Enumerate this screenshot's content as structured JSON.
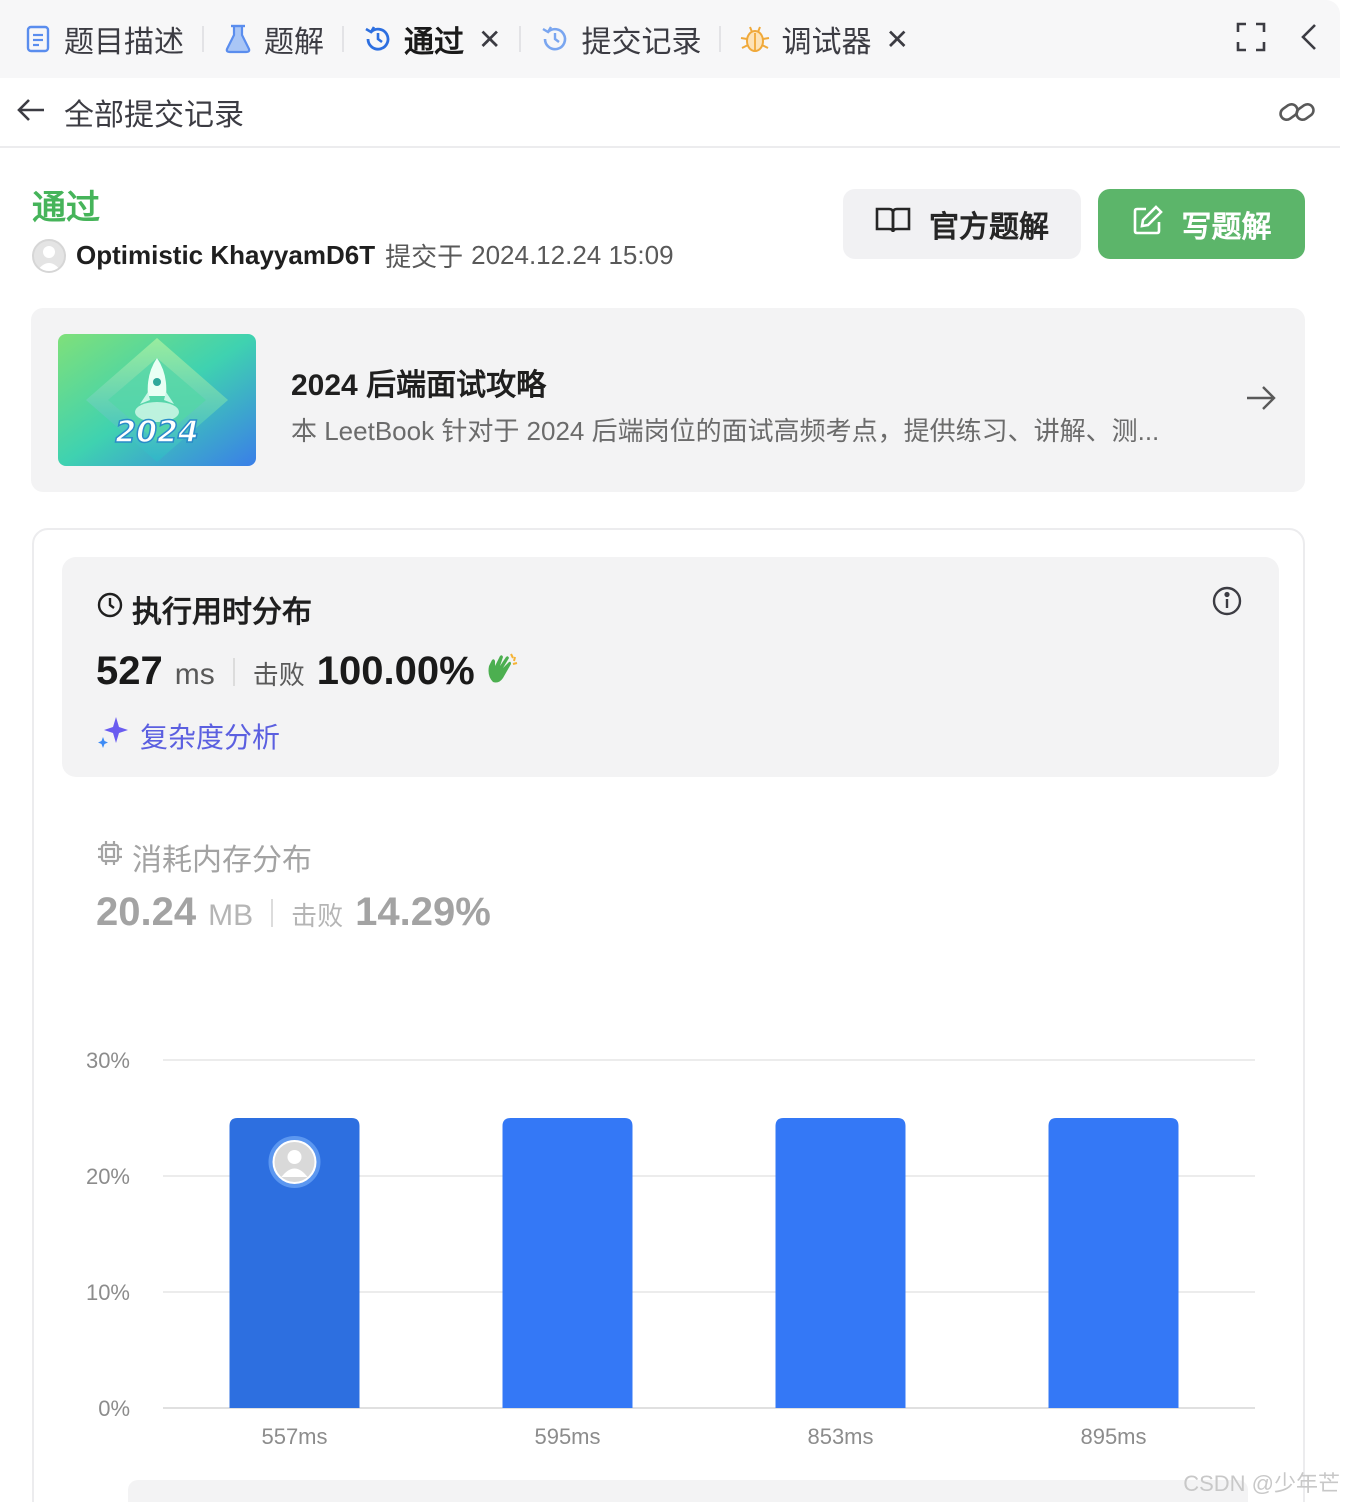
{
  "tabs": [
    {
      "label": "题目描述",
      "icon": "document-icon",
      "active": false,
      "closable": false
    },
    {
      "label": "题解",
      "icon": "flask-icon",
      "active": false,
      "closable": false
    },
    {
      "label": "通过",
      "icon": "history-icon",
      "active": true,
      "closable": true
    },
    {
      "label": "提交记录",
      "icon": "history-icon",
      "active": false,
      "closable": false
    },
    {
      "label": "调试器",
      "icon": "bug-icon",
      "active": false,
      "closable": true
    }
  ],
  "tab_bar_actions": [
    "fullscreen-icon",
    "collapse-chevron-icon"
  ],
  "subheader": {
    "title": "全部提交记录",
    "back_icon": "arrow-left-icon",
    "link_icon": "link-icon"
  },
  "submission": {
    "status": "通过",
    "status_color": "#46b45a",
    "user": "Optimistic KhayyamD6T",
    "submitted_prefix": "提交于",
    "submitted_at": "2024.12.24 15:09"
  },
  "buttons": {
    "official_solution": "官方题解",
    "write_solution": "写题解",
    "write_color": "#5cb56a"
  },
  "leetbook": {
    "cover_text": "2024",
    "title": "2024 后端面试攻略",
    "description": "本 LeetBook 针对于 2024 后端岗位的面试高频考点，提供练习、讲解、测..."
  },
  "runtime": {
    "title": "执行用时分布",
    "value": "527",
    "unit": "ms",
    "beat_label": "击败",
    "beat_percent": "100.00%",
    "analysis_label": "复杂度分析"
  },
  "memory": {
    "title": "消耗内存分布",
    "value": "20.24",
    "unit": "MB",
    "beat_label": "击败",
    "beat_percent": "14.29%"
  },
  "chart_data": {
    "type": "bar",
    "categories": [
      "557ms",
      "595ms",
      "853ms",
      "895ms"
    ],
    "values": [
      25,
      25,
      25,
      25
    ],
    "y_ticks": [
      "0%",
      "10%",
      "20%",
      "30%"
    ],
    "ylim": [
      0,
      30
    ],
    "highlight_index": 0,
    "bar_color": "#3478f6",
    "highlight_color": "#2d6fe0",
    "grid": true
  },
  "watermark": "CSDN @少年芒"
}
